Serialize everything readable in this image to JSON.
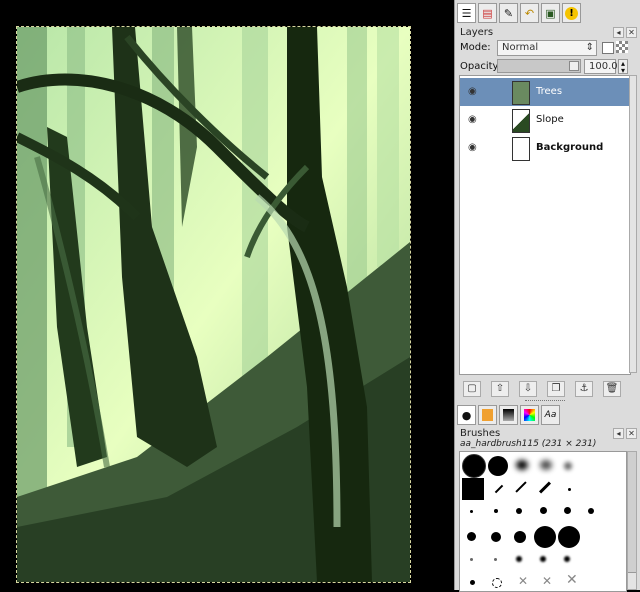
{
  "panel_tabs": [
    {
      "icon": "layers-icon"
    },
    {
      "icon": "channels-icon"
    },
    {
      "icon": "paths-icon"
    },
    {
      "icon": "undo-icon"
    },
    {
      "icon": "image-icon"
    },
    {
      "icon": "warning-icon"
    }
  ],
  "layers_panel": {
    "title": "Layers",
    "mode_label": "Mode:",
    "mode_value": "Normal",
    "opacity_label": "Opacity:",
    "opacity_value": "100.0",
    "layers": [
      {
        "name": "Trees",
        "selected": true
      },
      {
        "name": "Slope",
        "selected": false
      },
      {
        "name": "Background",
        "selected": false
      }
    ]
  },
  "brushes_panel": {
    "title": "Brushes",
    "current_brush": "aa_hardbrush115 (231 × 231)"
  },
  "colors": {
    "selection": "#6c8fb8",
    "panel_bg": "#dcdcdc"
  }
}
